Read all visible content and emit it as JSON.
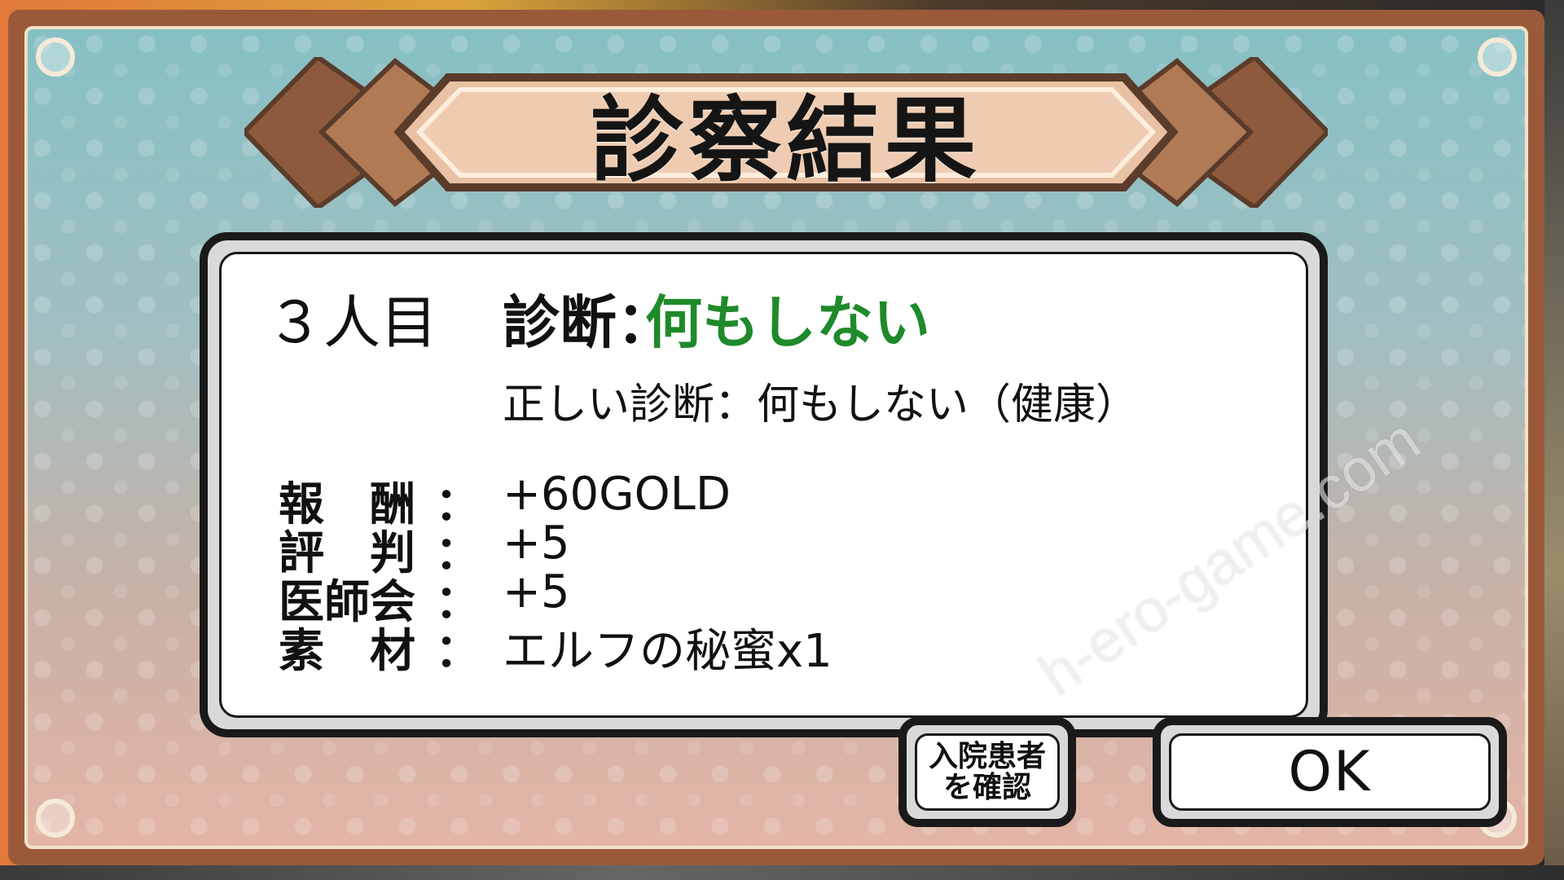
{
  "dialog": {
    "title": "診察結果"
  },
  "result": {
    "patient_number": "３人目",
    "diagnosis_label": "診断：",
    "diagnosis_value": "何もしない",
    "correct_diagnosis": "正しい診断：何もしない（健康）",
    "rows": [
      {
        "label": "報　酬",
        "colon": "：",
        "value": "+60GOLD"
      },
      {
        "label": "評　判",
        "colon": "：",
        "value": "+5"
      },
      {
        "label": "医師会",
        "colon": "：",
        "value": "+5"
      },
      {
        "label": "素　材",
        "colon": "：",
        "value": "エルフの秘蜜x1"
      }
    ]
  },
  "buttons": {
    "check_inpatients": "入院患者\nを確認",
    "ok": "OK"
  },
  "watermark": {
    "text": "h-ero-game.com"
  },
  "colors": {
    "frame": "#9a5a3a",
    "diagnosis_value": "#1f8a2a",
    "panel_border": "#1a1a1a"
  }
}
